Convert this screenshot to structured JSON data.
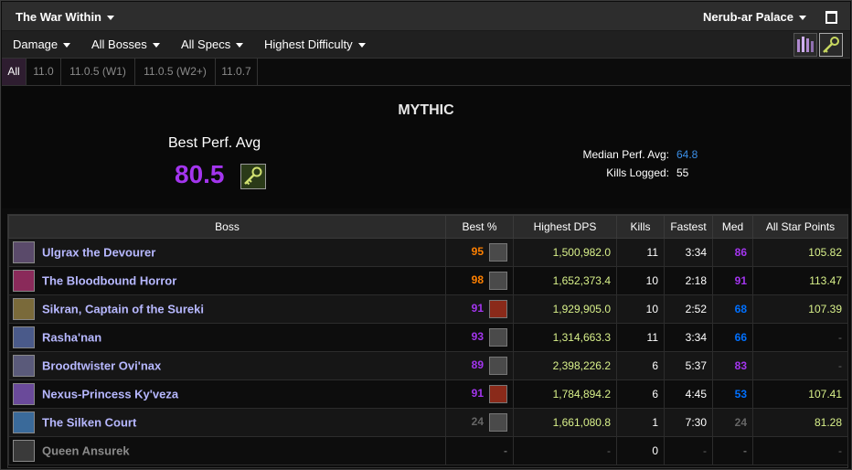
{
  "topbar": {
    "expansion": "The War Within",
    "zone": "Nerub-ar Palace",
    "window_icon": "window-square-icon"
  },
  "filters": {
    "metric": "Damage",
    "bosses": "All Bosses",
    "specs": "All Specs",
    "difficulty": "Highest Difficulty"
  },
  "tabs": [
    "All",
    "11.0",
    "11.0.5 (W1)",
    "11.0.5 (W2+)",
    "11.0.7"
  ],
  "summary": {
    "difficulty": "MYTHIC",
    "best_perf_label": "Best Perf. Avg",
    "best_perf_value": "80.5",
    "median_label": "Median Perf. Avg:",
    "median_value": "64.8",
    "kills_label": "Kills Logged:",
    "kills_value": "55"
  },
  "colors": {
    "epic": "#a335ee",
    "legendary": "#ff8000",
    "rare": "#0070ff",
    "gray": "#666666",
    "gold": "#e5cc80",
    "star": "#d8f08a",
    "pink": "#e268a8"
  },
  "table": {
    "headers": [
      "Boss",
      "Best %",
      "Highest DPS",
      "Kills",
      "Fastest",
      "Med",
      "All Star Points"
    ],
    "rows": [
      {
        "boss": "Ulgrax the Devourer",
        "icon_color": "#5a4a6a",
        "best": "95",
        "best_color": "#ff8000",
        "spec_icon": "arms-icon",
        "dps": "1,500,982.0",
        "kills": "11",
        "fastest": "3:34",
        "med": "86",
        "med_color": "#a335ee",
        "asp": "105.82"
      },
      {
        "boss": "The Bloodbound Horror",
        "icon_color": "#8a2a5a",
        "best": "98",
        "best_color": "#ff8000",
        "spec_icon": "arms-icon",
        "dps": "1,652,373.4",
        "kills": "10",
        "fastest": "2:18",
        "med": "91",
        "med_color": "#a335ee",
        "asp": "113.47"
      },
      {
        "boss": "Sikran, Captain of the Sureki",
        "icon_color": "#7a6a3a",
        "best": "91",
        "best_color": "#a335ee",
        "spec_icon": "fury-icon",
        "dps": "1,929,905.0",
        "kills": "10",
        "fastest": "2:52",
        "med": "68",
        "med_color": "#0070ff",
        "asp": "107.39"
      },
      {
        "boss": "Rasha'nan",
        "icon_color": "#4a5a8a",
        "best": "93",
        "best_color": "#a335ee",
        "spec_icon": "arms-icon",
        "dps": "1,314,663.3",
        "kills": "11",
        "fastest": "3:34",
        "med": "66",
        "med_color": "#0070ff",
        "asp": "-"
      },
      {
        "boss": "Broodtwister Ovi'nax",
        "icon_color": "#5a5a7a",
        "best": "89",
        "best_color": "#a335ee",
        "spec_icon": "arms-icon",
        "dps": "2,398,226.2",
        "kills": "6",
        "fastest": "5:37",
        "med": "83",
        "med_color": "#a335ee",
        "asp": "-"
      },
      {
        "boss": "Nexus-Princess Ky'veza",
        "icon_color": "#6a4a9a",
        "best": "91",
        "best_color": "#a335ee",
        "spec_icon": "fury-icon",
        "dps": "1,784,894.2",
        "kills": "6",
        "fastest": "4:45",
        "med": "53",
        "med_color": "#0070ff",
        "asp": "107.41"
      },
      {
        "boss": "The Silken Court",
        "icon_color": "#3a6a9a",
        "best": "24",
        "best_color": "#666666",
        "spec_icon": "arms-icon",
        "dps": "1,661,080.8",
        "kills": "1",
        "fastest": "7:30",
        "med": "24",
        "med_color": "#666666",
        "asp": "81.28"
      },
      {
        "boss": "Queen Ansurek",
        "icon_color": "#3a3a3a",
        "best": "-",
        "best_color": "#666666",
        "spec_icon": "",
        "dps": "-",
        "kills": "0",
        "fastest": "-",
        "med": "-",
        "med_color": "#666666",
        "asp": "-"
      }
    ]
  }
}
